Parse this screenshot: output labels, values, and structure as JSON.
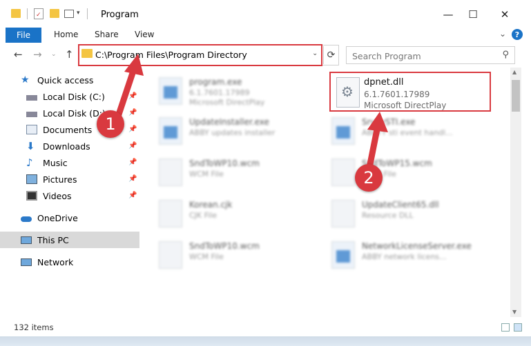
{
  "window": {
    "title": "Program",
    "minimize": "—",
    "maximize": "☐",
    "close": "✕"
  },
  "ribbon": {
    "tabs": [
      "File",
      "Home",
      "Share",
      "View"
    ],
    "help": "?"
  },
  "address": {
    "path": "C:\\Program Files\\Program Directory",
    "search_placeholder": "Search Program"
  },
  "nav": {
    "quick_access": "Quick access",
    "items": [
      {
        "label": "Local Disk (C:)",
        "icon": "drive-icon",
        "pinned": true
      },
      {
        "label": "Local Disk (D:)",
        "icon": "drive-icon",
        "pinned": true
      },
      {
        "label": "Documents",
        "icon": "documents-icon",
        "pinned": true
      },
      {
        "label": "Downloads",
        "icon": "downloads-icon",
        "pinned": true
      },
      {
        "label": "Music",
        "icon": "music-icon",
        "pinned": true
      },
      {
        "label": "Pictures",
        "icon": "pictures-icon",
        "pinned": true
      },
      {
        "label": "Videos",
        "icon": "videos-icon",
        "pinned": true
      }
    ],
    "onedrive": "OneDrive",
    "this_pc": "This PC",
    "network": "Network"
  },
  "files": [
    {
      "name": "program.exe",
      "meta1": "6.1.7601.17989",
      "meta2": "Microsoft DirectPlay",
      "type": "exe"
    },
    {
      "name": "UpdateInstaller.exe",
      "meta1": "ABBY updates installer",
      "meta2": "",
      "type": "exe"
    },
    {
      "name": "SrvyySTI.exe",
      "meta1": "ABBYY sti event handl...",
      "meta2": "",
      "type": "exe"
    },
    {
      "name": "SndToWP10.wcm",
      "meta1": "WCM File",
      "meta2": "",
      "type": "doc"
    },
    {
      "name": "SndToWP15.wcm",
      "meta1": "WCM File",
      "meta2": "",
      "type": "doc"
    },
    {
      "name": "Korean.cjk",
      "meta1": "CJK File",
      "meta2": "",
      "type": "doc"
    },
    {
      "name": "UpdateClient65.dll",
      "meta1": "Resource DLL",
      "meta2": "",
      "type": "dll"
    },
    {
      "name": "SndToWP10.wcm",
      "meta1": "WCM File",
      "meta2": "",
      "type": "doc"
    },
    {
      "name": "NetworkLicenseServer.exe",
      "meta1": "ABBY network licens...",
      "meta2": "",
      "type": "exe"
    }
  ],
  "focus_file": {
    "name": "dpnet.dll",
    "version": "6.1.7601.17989",
    "description": "Microsoft DirectPlay"
  },
  "status": {
    "count": "132 items"
  },
  "annotations": {
    "step1": "1",
    "step2": "2",
    "accent": "#d9393f"
  }
}
